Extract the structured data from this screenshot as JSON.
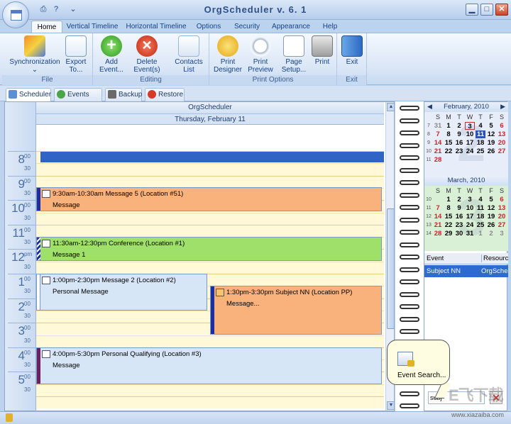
{
  "window": {
    "title": "OrgScheduler v. 6. 1",
    "minimize": "▁",
    "maximize": "□",
    "close": "✕"
  },
  "qat": {
    "print_icon": "print-icon",
    "help_icon": "help-icon",
    "dropdown_icon": "chevron-down-icon"
  },
  "tabs": [
    "Home",
    "Vertical Timeline",
    "Horizontal Timeline",
    "Options",
    "Security",
    "Appearance",
    "Help"
  ],
  "ribbon": {
    "groups": {
      "file": "File",
      "editing": "Editing",
      "print_options": "Print Options",
      "exit": "Exit"
    },
    "buttons": {
      "synchronization": "Synchronization",
      "export": "Export",
      "export2": "To...",
      "add_event": "Add",
      "add_event2": "Event...",
      "delete_event": "Delete",
      "delete_event2": "Event(s)",
      "contacts": "Contacts",
      "contacts2": "List",
      "print_designer": "Print",
      "print_designer2": "Designer",
      "print_preview": "Print",
      "print_preview2": "Preview",
      "page_setup": "Page",
      "page_setup2": "Setup...",
      "print": "Print",
      "exit": "Exit"
    }
  },
  "view_tabs": [
    "Scheduler",
    "Events List",
    "Backup",
    "Restore"
  ],
  "calendar": {
    "header": "OrgScheduler",
    "day": "Thursday, February 11",
    "hours": [
      {
        "h": "8",
        "m": "00",
        "half": "30"
      },
      {
        "h": "9",
        "m": "00",
        "half": "30"
      },
      {
        "h": "10",
        "m": "00",
        "half": "30"
      },
      {
        "h": "11",
        "m": "00",
        "half": "30"
      },
      {
        "h": "12",
        "m": "pm",
        "half": "30"
      },
      {
        "h": "1",
        "m": "00",
        "half": "30"
      },
      {
        "h": "2",
        "m": "00",
        "half": "30"
      },
      {
        "h": "3",
        "m": "00",
        "half": "30"
      },
      {
        "h": "4",
        "m": "00",
        "half": "30"
      },
      {
        "h": "5",
        "m": "00",
        "half": "30"
      }
    ],
    "events": [
      {
        "title": "9:30am-10:30am Message 5 (Location #51)",
        "body": "Message",
        "color": "#f9b27c",
        "bar": "#1f2e9e"
      },
      {
        "title": "11:30am-12:30pm Conference (Location #1)",
        "body": "Message 1",
        "color": "#9ee06a",
        "bar": "#1f2e9e"
      },
      {
        "title": "1:00pm-2:30pm Message 2 (Location #2)",
        "body": "Personal Message",
        "color": "#d7e6f7",
        "bar": "#ffffff"
      },
      {
        "title": "1:30pm-3:30pm Subject NN (Location PP)",
        "body": "Message...",
        "color": "#f9b27c",
        "bar": "#1f2e9e"
      },
      {
        "title": "4:00pm-5:30pm Personal Qualifying (Location #3)",
        "body": "Message",
        "color": "#d7e6f7",
        "bar": "#6b1f5e"
      }
    ],
    "allday_color": "#2f63c6"
  },
  "mini_calendars": [
    {
      "title": "February, 2010",
      "dow": [
        "S",
        "M",
        "T",
        "W",
        "T",
        "F",
        "S"
      ],
      "weeks": [
        "6",
        "7",
        "8",
        "9",
        "10",
        "11"
      ],
      "rows": [
        [
          "31",
          "1",
          "2",
          "3",
          "4",
          "5",
          "6"
        ],
        [
          "7",
          "8",
          "9",
          "10",
          "11",
          "12",
          "13"
        ],
        [
          "14",
          "15",
          "16",
          "17",
          "18",
          "19",
          "20"
        ],
        [
          "21",
          "22",
          "23",
          "24",
          "25",
          "26",
          "27"
        ],
        [
          "28",
          "",
          "",
          "",
          "",
          "",
          ""
        ]
      ],
      "background": "#e8eef9",
      "watermark": "2"
    },
    {
      "title": "March, 2010",
      "dow": [
        "S",
        "M",
        "T",
        "W",
        "T",
        "F",
        "S"
      ],
      "weeks": [
        "10",
        "11",
        "12",
        "13",
        "14"
      ],
      "rows": [
        [
          "",
          "1",
          "2",
          "3",
          "4",
          "5",
          "6"
        ],
        [
          "7",
          "8",
          "9",
          "10",
          "11",
          "12",
          "13"
        ],
        [
          "14",
          "15",
          "16",
          "17",
          "18",
          "19",
          "20"
        ],
        [
          "21",
          "22",
          "23",
          "24",
          "25",
          "26",
          "27"
        ],
        [
          "28",
          "29",
          "30",
          "31",
          "1",
          "2",
          "3"
        ]
      ],
      "background": "#d9efd6",
      "watermark": "3"
    }
  ],
  "event_list": {
    "headers": [
      "Event",
      "Resource"
    ],
    "row": [
      "Subject NN",
      "OrgScheduler"
    ]
  },
  "search": {
    "value": "subj",
    "tooltip": "Event Search..."
  },
  "watermark": {
    "logo": "E飞下载",
    "url": "www.xiazaiba.com"
  }
}
